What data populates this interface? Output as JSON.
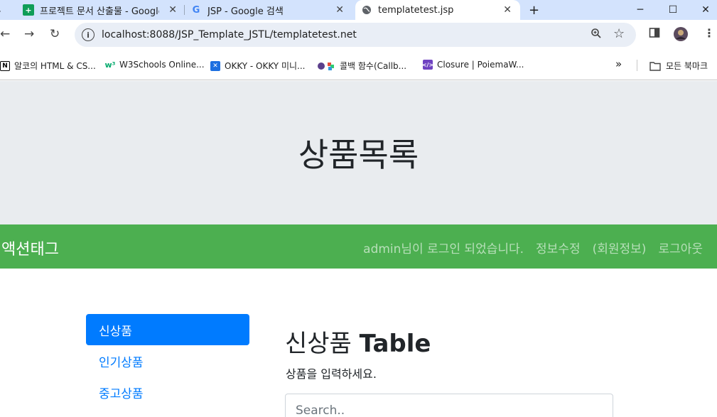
{
  "browser": {
    "tabs": [
      {
        "title": "프로젝트 문서 산출물 - Google",
        "favicon": "sheets-icon"
      },
      {
        "title": "JSP - Google 검색",
        "favicon": "google-icon"
      },
      {
        "title": "templatetest.jsp",
        "favicon": "globe-icon",
        "active": true
      }
    ],
    "new_tab": "+",
    "url": "localhost:8088/JSP_Template_JSTL/templatetest.net",
    "bookmarks": [
      {
        "label": "알코의 HTML & CS...",
        "icon": "notion-icon"
      },
      {
        "label": "W3Schools Online...",
        "icon": "w3schools-icon"
      },
      {
        "label": "OKKY - OKKY 미니...",
        "icon": "okky-icon"
      },
      {
        "label": "콜백 함수(Callb...",
        "icon": "bookmark-icon"
      },
      {
        "label": "Closure | PoiemaW...",
        "icon": "code-icon"
      }
    ],
    "more_bookmarks": "»",
    "all_bookmarks": "모든 북마크"
  },
  "page": {
    "jumbotron_title": "상품목록",
    "navbar": {
      "brand": "액션태그",
      "links": [
        "admin님이 로그인 되었습니다.",
        "정보수정",
        "(회원정보)",
        "로그아웃"
      ]
    },
    "sidebar": {
      "items": [
        {
          "label": "신상품",
          "active": true
        },
        {
          "label": "인기상품",
          "active": false
        },
        {
          "label": "중고상품",
          "active": false
        }
      ]
    },
    "main": {
      "heading_prefix": "신상품 ",
      "heading_bold": "Table",
      "description": "상품을 입력하세요.",
      "search_placeholder": "Search.."
    }
  },
  "colors": {
    "navbar": "#4caf50",
    "jumbotron": "#e9ecef",
    "active_item": "#007bff",
    "tab_strip": "#d3e3fd"
  }
}
